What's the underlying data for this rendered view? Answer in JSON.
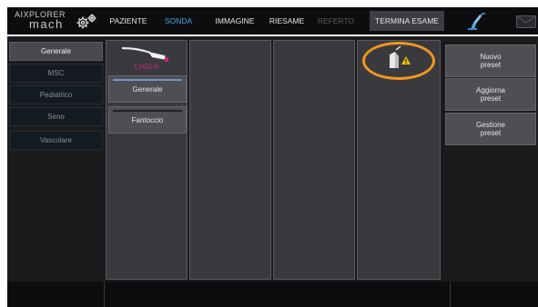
{
  "header": {
    "logo_top": "AIXPLORER",
    "logo_bottom": "mach",
    "tabs": [
      {
        "label": "PAZIENTE",
        "state": "normal"
      },
      {
        "label": "SONDA",
        "state": "active"
      },
      {
        "label": "IMMAGINE",
        "state": "normal"
      },
      {
        "label": "RIESAME",
        "state": "normal"
      },
      {
        "label": "REFERTO",
        "state": "disabled"
      }
    ],
    "end_exam_label": "TERMINA ESAME",
    "icons": [
      "settings-gears-icon",
      "probe-connect-icon",
      "mail-icon"
    ]
  },
  "categories": [
    {
      "label": "Generale",
      "selected": true
    },
    {
      "label": "MSC",
      "selected": false
    },
    {
      "label": "Pediatrico",
      "selected": false
    },
    {
      "label": "Seno",
      "selected": false
    },
    {
      "label": "Vascolare",
      "selected": false
    }
  ],
  "probe": {
    "name": "LH20-6",
    "presets": [
      {
        "label": "Generale",
        "selected": true
      },
      {
        "label": "Fantoccio",
        "selected": false
      }
    ]
  },
  "warning_icon": "probe-warning-icon",
  "side_buttons": [
    {
      "label": "Nuovo preset"
    },
    {
      "label": "Aggiorna preset"
    },
    {
      "label": "Gestione preset"
    }
  ],
  "colors": {
    "active_tab": "#4aa6e6",
    "probe_name": "#c4267a",
    "highlight_ring": "#f0961e",
    "warning": "#f2c200"
  }
}
